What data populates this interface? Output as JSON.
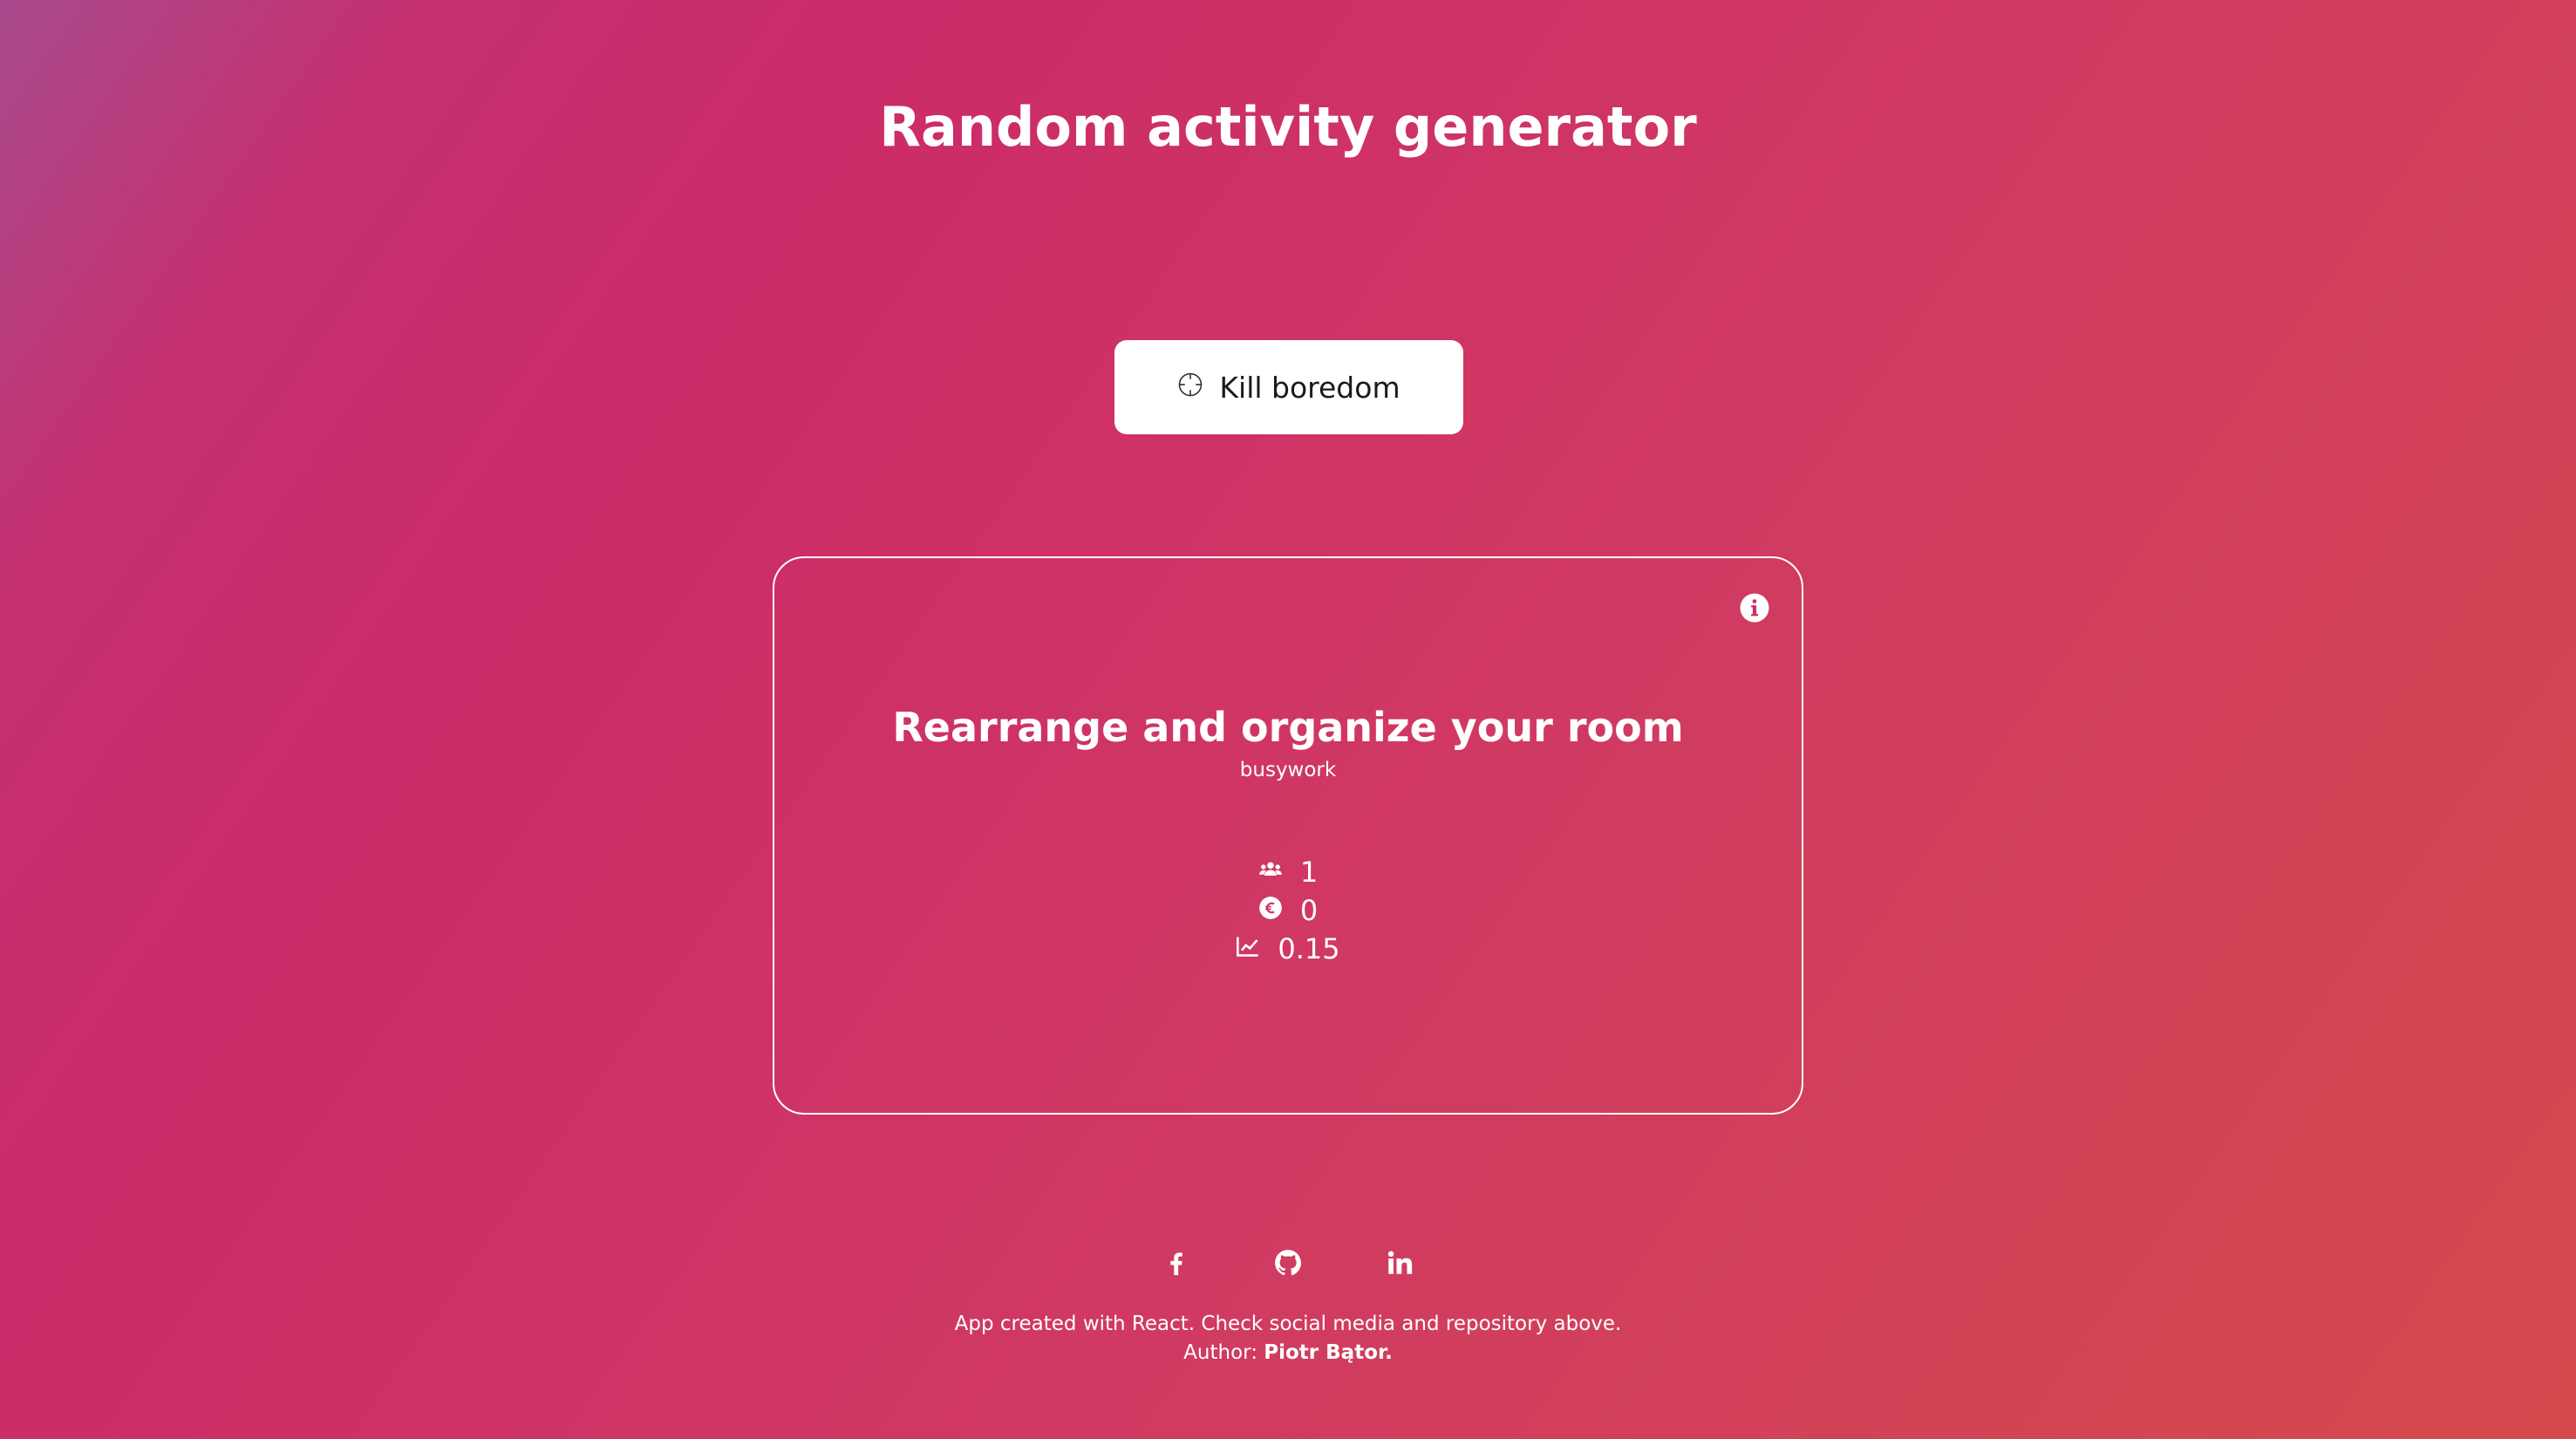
{
  "header": {
    "title": "Random activity generator"
  },
  "action_button": {
    "label": "Kill boredom",
    "icon": "crosshair-icon"
  },
  "activity_card": {
    "title": "Rearrange and organize your room",
    "type": "busywork",
    "info_icon": "info-icon",
    "stats": [
      {
        "icon": "participants-icon",
        "value": "1"
      },
      {
        "icon": "euro-icon",
        "value": "0"
      },
      {
        "icon": "accessibility-chart-icon",
        "value": "0.15"
      }
    ]
  },
  "footer": {
    "social_links": [
      {
        "icon": "facebook-icon"
      },
      {
        "icon": "github-icon"
      },
      {
        "icon": "linkedin-icon"
      }
    ],
    "description": "App created with React. Check social media and repository above.",
    "author_label": "Author:",
    "author_name": "Piotr Bątor."
  },
  "colors": {
    "gradient_start": "#a84a8c",
    "gradient_mid": "#cc2c68",
    "gradient_end": "#d44a4c",
    "button_bg": "#ffffff",
    "text": "#ffffff"
  }
}
